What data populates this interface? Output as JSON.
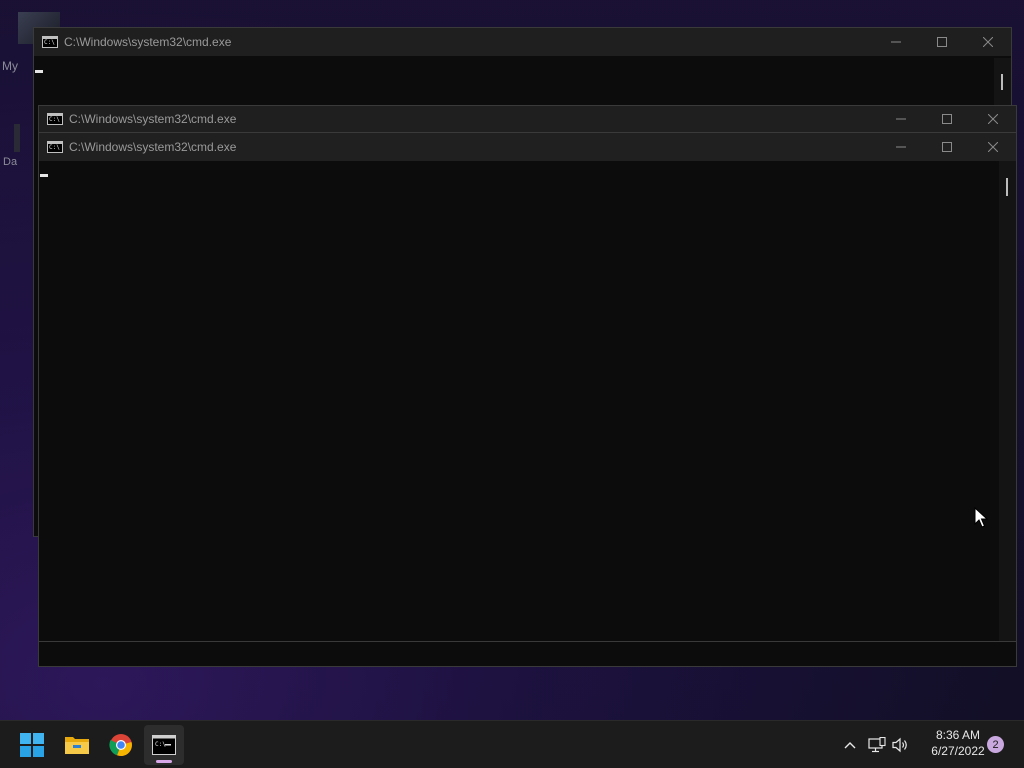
{
  "desktop": {
    "labels": [
      "My",
      "Da"
    ]
  },
  "windows": [
    {
      "title": "C:\\Windows\\system32\\cmd.exe",
      "state": "background"
    },
    {
      "title": "C:\\Windows\\system32\\cmd.exe",
      "state": "middle"
    },
    {
      "title": "C:\\Windows\\system32\\cmd.exe",
      "state": "foreground"
    }
  ],
  "window_controls": {
    "minimize": "—",
    "maximize": "☐",
    "close": "✕"
  },
  "taskbar": {
    "apps": [
      {
        "name": "Start",
        "icon": "windows-logo-icon"
      },
      {
        "name": "File Explorer",
        "icon": "folder-icon"
      },
      {
        "name": "Google Chrome",
        "icon": "chrome-icon"
      },
      {
        "name": "Command Prompt",
        "icon": "cmd-icon",
        "active": true
      }
    ],
    "tray": {
      "icons": [
        "chevron-up-icon",
        "network-icon",
        "volume-icon"
      ],
      "time": "8:36 AM",
      "date": "6/27/2022",
      "notification_count": "2"
    }
  },
  "colors": {
    "accent": "#d8a8e8",
    "titlebar": "#202020",
    "console_bg": "#0c0c0c",
    "taskbar": "#1c1c1c"
  }
}
